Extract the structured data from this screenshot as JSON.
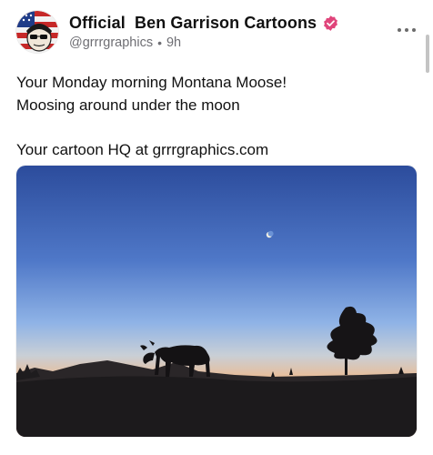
{
  "post": {
    "author": {
      "display_name": "Official  Ben Garrison Cartoons",
      "handle": "@grrrgraphics",
      "time": "9h",
      "avatar_icon": "cartoon-avatar-icon",
      "verified_icon": "verified-badge-icon",
      "verified_color": "#e0457b"
    },
    "text_lines": [
      "Your Monday morning Montana Moose!",
      "Moosing around under the moon",
      "",
      "Your cartoon HQ at grrrgraphics.com"
    ],
    "more_icon": "more-options-icon",
    "image": {
      "subject_icon": "moose-silhouette-icon",
      "sky_top_color": "#2f4f9e",
      "horizon_color": "#f5a15a"
    }
  }
}
